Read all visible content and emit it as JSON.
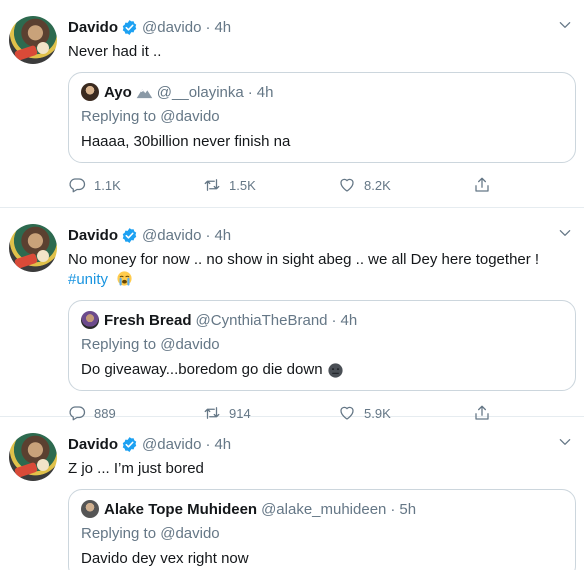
{
  "tweets": [
    {
      "author": {
        "name": "Davido",
        "handle": "@davido",
        "time": "4h"
      },
      "text": "Never had it ..",
      "hashtag": "",
      "quote": {
        "name": "Ayo",
        "handle": "@__olayinka",
        "time": "4h",
        "replying_to": "Replying to @davido",
        "text": "Haaaa, 30billion never finish na"
      },
      "actions": {
        "replies": "1.1K",
        "retweets": "1.5K",
        "likes": "8.2K"
      }
    },
    {
      "author": {
        "name": "Davido",
        "handle": "@davido",
        "time": "4h"
      },
      "text": "No money for now .. no show in sight abeg .. we all Dey here together !",
      "hashtag": "#unity",
      "quote": {
        "name": "Fresh Bread",
        "handle": "@CynthiaTheBrand",
        "time": "4h",
        "replying_to": "Replying to @davido",
        "text": "Do giveaway...boredom go die down"
      },
      "actions": {
        "replies": "889",
        "retweets": "914",
        "likes": "5.9K"
      }
    },
    {
      "author": {
        "name": "Davido",
        "handle": "@davido",
        "time": "4h"
      },
      "text": "Z jo ... I’m just bored",
      "hashtag": "",
      "quote": {
        "name": "Alake Tope Muhideen",
        "handle": "@alake_muhideen",
        "time": "5h",
        "replying_to": "Replying to @davido",
        "text": "Davido dey vex right now"
      }
    }
  ],
  "separator": "·",
  "icons": [
    "verified-icon",
    "caret-down-icon",
    "reply-icon",
    "retweet-icon",
    "like-icon",
    "share-icon",
    "mountain-emoji-icon",
    "crying-emoji-icon",
    "neutral-face-emoji-icon"
  ],
  "colors": {
    "accent": "#1da1f2",
    "hashtag": "#1b95e0",
    "muted": "#657786",
    "border": "#ccd6dd"
  }
}
